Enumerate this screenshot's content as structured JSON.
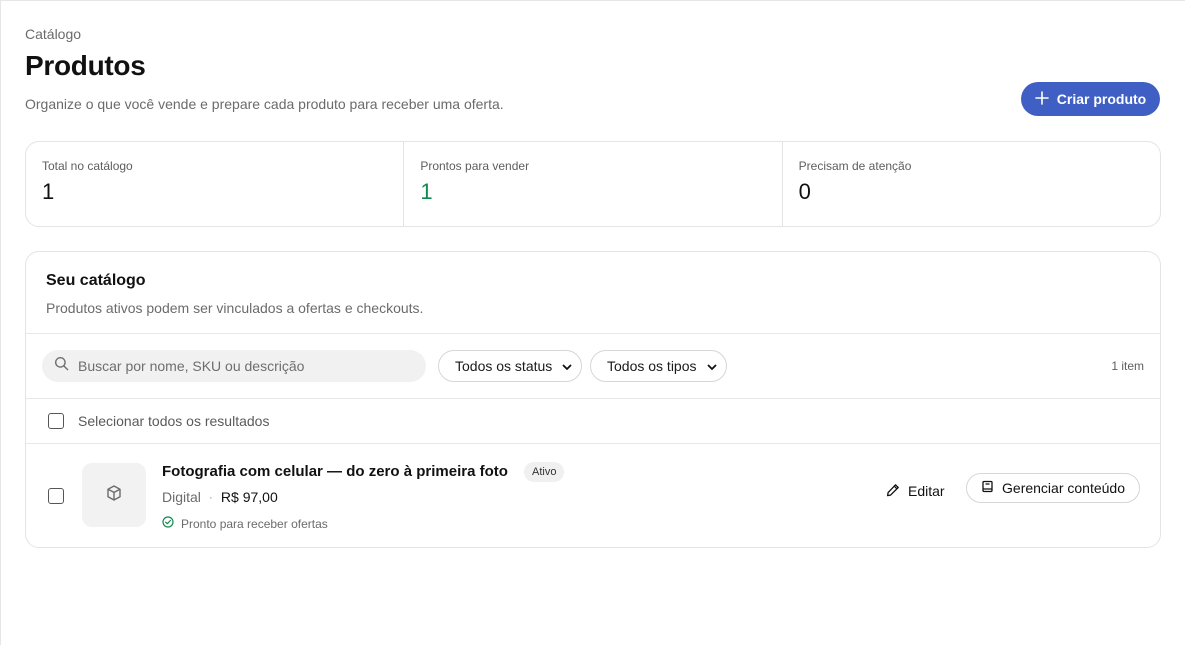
{
  "header": {
    "breadcrumb": "Catálogo",
    "title": "Produtos",
    "subtitle": "Organize o que você vende e prepare cada produto para receber uma oferta.",
    "create_button_label": "Criar produto",
    "accent_color": "#3f5fc4"
  },
  "stats": [
    {
      "label": "Total no catálogo",
      "value": "1"
    },
    {
      "label": "Prontos para vender",
      "value": "1",
      "color": "#138a4e"
    },
    {
      "label": "Precisam de atenção",
      "value": "0"
    }
  ],
  "catalog": {
    "title": "Seu catálogo",
    "description": "Produtos ativos podem ser vinculados a ofertas e checkouts.",
    "search_placeholder": "Buscar por nome, SKU ou descrição",
    "status_filter": "Todos os status",
    "type_filter": "Todos os tipos",
    "count": "1 item",
    "select_all_label": "Selecionar todos os resultados",
    "products": [
      {
        "name": "Fotografia com celular — do zero à primeira foto",
        "status": "Ativo",
        "type": "Digital",
        "price": "R$ 97,00",
        "ready_text": "Pronto para receber ofertas",
        "ready_icon": "check-circle-icon",
        "thumbnail_icon": "package-icon",
        "edit_label": "Editar",
        "manage_label": "Gerenciar conteúdo"
      }
    ]
  }
}
